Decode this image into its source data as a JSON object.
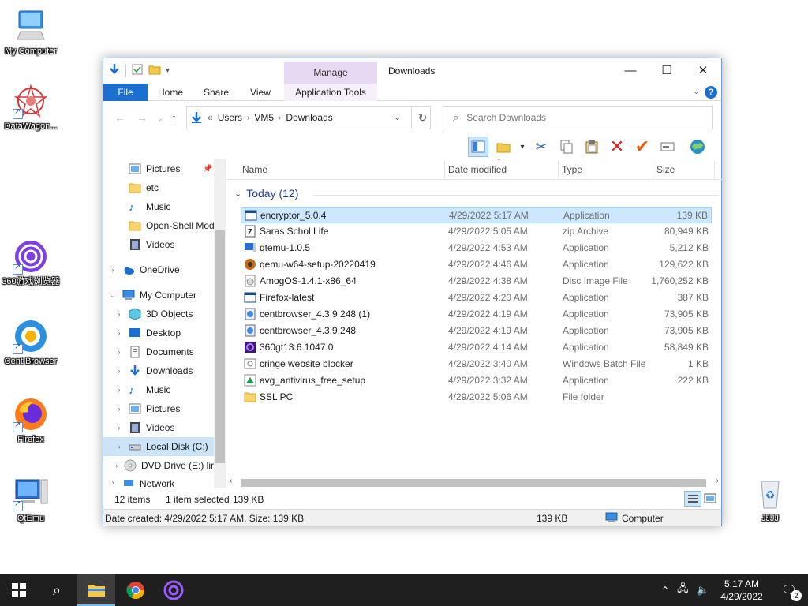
{
  "desktop": {
    "icons": [
      {
        "label": "My Computer"
      },
      {
        "label": "DataWagon..."
      },
      {
        "label": "360游戏浏览器"
      },
      {
        "label": "Cent Browser"
      },
      {
        "label": "Firefox"
      },
      {
        "label": "QtEmu"
      },
      {
        "label": "JJJJ"
      }
    ]
  },
  "window": {
    "title": "Downloads",
    "manage_tab": "Manage",
    "tabs": {
      "file": "File",
      "home": "Home",
      "share": "Share",
      "view": "View",
      "app_tools": "Application Tools"
    },
    "controls": {
      "minimize": "—",
      "maximize": "☐",
      "close": "✕"
    },
    "help": "?"
  },
  "address": {
    "prefix": "«",
    "crumbs": [
      "Users",
      "VM5",
      "Downloads"
    ],
    "search_placeholder": "Search Downloads"
  },
  "nav": {
    "items": [
      {
        "label": "Pictures"
      },
      {
        "label": "etc"
      },
      {
        "label": "Music"
      },
      {
        "label": "Open-Shell Mod"
      },
      {
        "label": "Videos"
      },
      {
        "label": "OneDrive"
      },
      {
        "label": "My Computer"
      },
      {
        "label": "3D Objects"
      },
      {
        "label": "Desktop"
      },
      {
        "label": "Documents"
      },
      {
        "label": "Downloads"
      },
      {
        "label": "Music"
      },
      {
        "label": "Pictures"
      },
      {
        "label": "Videos"
      },
      {
        "label": "Local Disk (C:)"
      },
      {
        "label": "DVD Drive (E:) lir"
      },
      {
        "label": "Network"
      }
    ]
  },
  "columns": {
    "name": "Name",
    "date": "Date modified",
    "type": "Type",
    "size": "Size"
  },
  "group": {
    "label": "Today (12)"
  },
  "files": [
    {
      "name": "encryptor_5.0.4",
      "date": "4/29/2022 5:17 AM",
      "type": "Application",
      "size": "139 KB"
    },
    {
      "name": "Saras Schol Life",
      "date": "4/29/2022 5:05 AM",
      "type": "zip Archive",
      "size": "80,949 KB"
    },
    {
      "name": "qtemu-1.0.5",
      "date": "4/29/2022 4:53 AM",
      "type": "Application",
      "size": "5,212 KB"
    },
    {
      "name": "qemu-w64-setup-20220419",
      "date": "4/29/2022 4:46 AM",
      "type": "Application",
      "size": "129,622 KB"
    },
    {
      "name": "AmogOS-1.4.1-x86_64",
      "date": "4/29/2022 4:38 AM",
      "type": "Disc Image File",
      "size": "1,760,252 KB"
    },
    {
      "name": "Firefox-latest",
      "date": "4/29/2022 4:20 AM",
      "type": "Application",
      "size": "387 KB"
    },
    {
      "name": "centbrowser_4.3.9.248 (1)",
      "date": "4/29/2022 4:19 AM",
      "type": "Application",
      "size": "73,905 KB"
    },
    {
      "name": "centbrowser_4.3.9.248",
      "date": "4/29/2022 4:19 AM",
      "type": "Application",
      "size": "73,905 KB"
    },
    {
      "name": "360gt13.6.1047.0",
      "date": "4/29/2022 4:14 AM",
      "type": "Application",
      "size": "58,849 KB"
    },
    {
      "name": "cringe website blocker",
      "date": "4/29/2022 3:40 AM",
      "type": "Windows Batch File",
      "size": "1 KB"
    },
    {
      "name": "avg_antivirus_free_setup",
      "date": "4/29/2022 3:32 AM",
      "type": "Application",
      "size": "222 KB"
    },
    {
      "name": "SSL PC",
      "date": "4/29/2022 5:06 AM",
      "type": "File folder",
      "size": ""
    }
  ],
  "status": {
    "count": "12 items",
    "selected": "1 item selected",
    "size": "139 KB"
  },
  "details": {
    "info": "Date created: 4/29/2022 5:17 AM, Size: 139 KB",
    "size": "139 KB",
    "location": "Computer"
  },
  "taskbar": {
    "time": "5:17 AM",
    "date": "4/29/2022",
    "notif_count": "2"
  }
}
